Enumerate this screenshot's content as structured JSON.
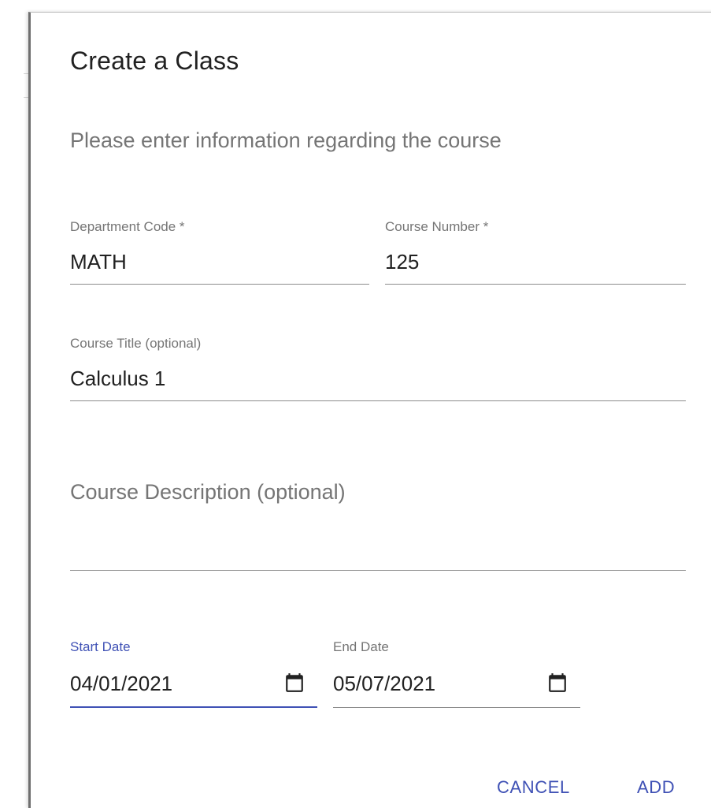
{
  "dialog": {
    "title": "Create a Class",
    "subtitle": "Please enter information regarding the course"
  },
  "fields": {
    "department_code": {
      "label": "Department Code *",
      "value": "MATH"
    },
    "course_number": {
      "label": "Course Number *",
      "value": "125"
    },
    "course_title": {
      "label": "Course Title (optional)",
      "value": "Calculus 1"
    },
    "course_description": {
      "placeholder": "Course Description (optional)",
      "value": ""
    },
    "start_date": {
      "label": "Start Date",
      "value": "04/01/2021",
      "icon": "calendar-icon"
    },
    "end_date": {
      "label": "End Date",
      "value": "05/07/2021",
      "icon": "calendar-icon"
    }
  },
  "actions": {
    "cancel_label": "CANCEL",
    "add_label": "ADD"
  },
  "colors": {
    "primary": "#3f51b5",
    "text": "#212121",
    "secondary_text": "#757575",
    "underline": "#8c8c8c"
  }
}
